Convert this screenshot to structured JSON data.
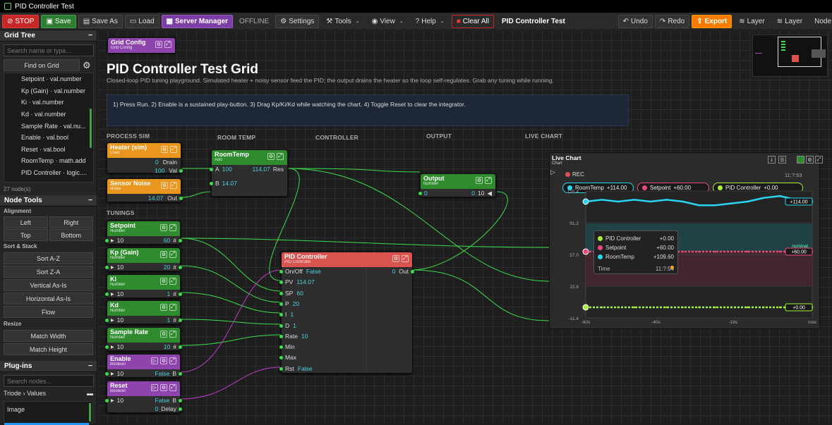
{
  "window": {
    "title": "PID Controller Test"
  },
  "toolbar": {
    "stop": "STOP",
    "save": "Save",
    "save_as": "Save As",
    "load": "Load",
    "server_manager": "Server Manager",
    "status": "OFFLINE",
    "settings": "Settings",
    "tools": "Tools",
    "view": "View",
    "help": "Help",
    "clear_all": "Clear All",
    "document_title": "PID Controller Test",
    "undo": "Undo",
    "redo": "Redo",
    "export": "Export",
    "layer1": "Layer",
    "layer2": "Layer",
    "node": "Node"
  },
  "grid_tree": {
    "title": "Grid Tree",
    "search_placeholder": "Search name or type...",
    "find_button": "Find on Grid",
    "items": [
      "Setpoint · val.number",
      "Kp (Gain) · val.number",
      "Ki · val.number",
      "Kd · val.number",
      "Sample Rate · val.nu...",
      "Enable · val.bool",
      "Reset · val.bool",
      "RoomTemp · math.add",
      "PID Controller · logic...."
    ],
    "count": "27 node(s)"
  },
  "node_tools": {
    "title": "Node Tools",
    "alignment": "Alignment",
    "left": "Left",
    "right": "Right",
    "top": "Top",
    "bottom": "Bottom",
    "sort_stack": "Sort & Stack",
    "sort_az": "Sort A-Z",
    "sort_za": "Sort Z-A",
    "vertical": "Vertical As-Is",
    "horizontal": "Horizontal As-Is",
    "flow": "Flow",
    "resize": "Resize",
    "match_width": "Match Width",
    "match_height": "Match Height"
  },
  "plugins": {
    "title": "Plug-ins",
    "search_placeholder": "Search nodes...",
    "category": "Triode › Values",
    "item": "Image"
  },
  "canvas": {
    "grid_config": {
      "title": "Grid Config",
      "sub": "Grid Config"
    },
    "title": "PID Controller Test Grid",
    "description": "Closed-loop PID tuning playground. Simulated heater + noisy sensor feed the PID; the output drains the heater so the loop self-regulates. Grab any tuning while running.",
    "instructions": "1) Press Run.  2) Enable is a sustained play-button.  3) Drag Kp/Ki/Kd while watching the chart.  4) Toggle Reset to clear the integrator.",
    "sections": {
      "process_sim": "PROCESS SIM",
      "room_temp": "ROOM TEMP",
      "controller": "CONTROLLER",
      "output": "OUTPUT",
      "live_chart": "LIVE CHART",
      "tunings": "TUNINGS"
    }
  },
  "nodes": {
    "heater": {
      "title": "Heater (sim)",
      "sub": "Load",
      "drain_val": "0",
      "drain_label": "Drain",
      "val_val": "100",
      "val_label": "Val"
    },
    "sensor": {
      "title": "Sensor Noise",
      "sub": "Noise",
      "out_val": "14.07",
      "out_label": "Out"
    },
    "roomtemp": {
      "title": "RoomTemp",
      "sub": "Add",
      "a_label": "A",
      "a_val": "100",
      "res_val": "114.07",
      "res_label": "Res",
      "b_label": "B",
      "b_val": "14.07"
    },
    "output": {
      "title": "Output",
      "sub": "Number",
      "in_val": "0",
      "out_val": "0",
      "out_num": "10"
    },
    "setpoint": {
      "title": "Setpoint",
      "sub": "Number",
      "in": "10",
      "val": "60",
      "hash": "#"
    },
    "kp": {
      "title": "Kp (Gain)",
      "sub": "Number",
      "in": "10",
      "val": "20",
      "hash": "#"
    },
    "ki": {
      "title": "Ki",
      "sub": "Number",
      "in": "10",
      "val": "1",
      "hash": "#"
    },
    "kd": {
      "title": "Kd",
      "sub": "Number",
      "in": "10",
      "val": "1",
      "hash": "#"
    },
    "rate": {
      "title": "Sample Rate",
      "sub": "Number",
      "in": "10",
      "val": "10",
      "hash": "#"
    },
    "enable": {
      "title": "Enable",
      "sub": "Boolean",
      "in": "10",
      "val": "False",
      "port": "B"
    },
    "reset": {
      "title": "Reset",
      "sub": "Boolean",
      "in": "10",
      "val": "False",
      "port": "B",
      "delay_val": "0",
      "delay_label": "Delay"
    },
    "pid": {
      "title": "PID Controller",
      "sub": "PID Controller",
      "onoff": "On/Off",
      "onoff_val": "False",
      "out_val": "0",
      "out_label": "Out",
      "pv": "PV",
      "pv_val": "114.07",
      "sp": "SP",
      "sp_val": "60",
      "p": "P",
      "p_val": "20",
      "i": "I",
      "i_val": "1",
      "d": "D",
      "d_val": "1",
      "rate": "Rate",
      "rate_val": "10",
      "min": "Min",
      "max": "Max",
      "rst": "Rst",
      "rst_val": "False"
    }
  },
  "chart": {
    "title": "Live Chart",
    "sub": "Chart",
    "rec": "REC",
    "time": "11:?:53",
    "legend": [
      {
        "name": "RoomTemp",
        "value": "+114.00",
        "color": "#29d4ee"
      },
      {
        "name": "Setpoint",
        "value": "+60.00",
        "color": "#e94a7a"
      },
      {
        "name": "PID Controller",
        "value": "+0.00",
        "color": "#a4f03a"
      }
    ],
    "tooltip": {
      "rows": [
        {
          "name": "PID Controller",
          "value": "+0.00",
          "color": "#a4f03a"
        },
        {
          "name": "Setpoint",
          "value": "+60.00",
          "color": "#e94a7a"
        },
        {
          "name": "RoomTemp",
          "value": "+109.60",
          "color": "#29d4ee"
        }
      ],
      "time_label": "Time",
      "time_value": "11:?:54"
    },
    "badges": {
      "roomtemp": "+114.00",
      "setpoint": "+60.00",
      "pid": "+0.00"
    },
    "nominal": "nominal"
  },
  "chart_data": {
    "type": "line",
    "x": [
      "-60s",
      "-40s",
      "-19s",
      "now"
    ],
    "ylim": [
      -11.4,
      125.4
    ],
    "yticks": [
      "125.4",
      "91.2",
      "57.0",
      "22.8",
      "-11.4"
    ],
    "series": [
      {
        "name": "RoomTemp",
        "values": [
          114,
          116,
          114,
          116,
          114,
          116,
          114,
          110,
          110,
          112,
          114,
          118,
          120,
          116,
          114
        ]
      },
      {
        "name": "Setpoint",
        "values": [
          60,
          60,
          60,
          60,
          60,
          60,
          60,
          60,
          60,
          60,
          60,
          60,
          60,
          60,
          60
        ]
      },
      {
        "name": "PID Controller",
        "values": [
          0,
          0,
          0,
          0,
          0,
          0,
          0,
          0,
          0,
          0,
          0,
          0,
          0,
          0,
          0
        ]
      }
    ]
  }
}
